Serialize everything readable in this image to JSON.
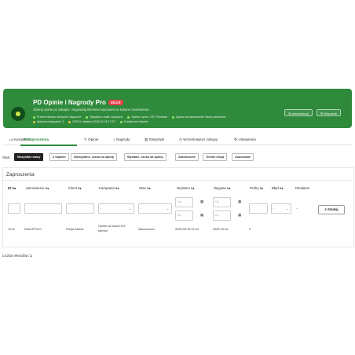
{
  "header": {
    "title": "PD Opinie i Nagrody Pro",
    "version": "v5.3.0",
    "description": "Zbieraj opinie po zakupie i nagradzaj klientów kuponami na kolejne zamówienia.",
    "statuses": [
      {
        "label": "Przeterminowe kampanii: włączone",
        "color": "#9be86a"
      },
      {
        "label": "Wysyłka e-maili: włączona",
        "color": "#9be86a"
      },
      {
        "label": "System opinii: OJIT Reviews",
        "color": "#9be86a"
      },
      {
        "label": "Zgoda na zaproszenie: ekran partnerów",
        "color": "#9be86a"
      },
      {
        "label": "Aktywne kampanie: 3",
        "color": "#f5c542"
      },
      {
        "label": "CRON: ostatnio 2026-09-26 17:07",
        "color": "#f5c542"
      },
      {
        "label": "Kolejka bez błędów",
        "color": "#9be86a"
      }
    ],
    "buttons": {
      "docs": "prestadev.pl",
      "support": "Wsparcie"
    }
  },
  "tabs": [
    {
      "label": "Kampanie",
      "icon": "thumbs-up-icon"
    },
    {
      "label": "Zaproszenia",
      "icon": "envelope-icon",
      "active": true
    },
    {
      "label": "Opinie",
      "icon": "chat-icon"
    },
    {
      "label": "Nagrody",
      "icon": "gift-icon"
    },
    {
      "label": "Statystyki",
      "icon": "bar-chart-icon"
    },
    {
      "label": "Wcześniejsze zakupy",
      "icon": "clock-icon"
    },
    {
      "label": "Ustawienia",
      "icon": "cogs-icon"
    }
  ],
  "filters": {
    "label": "Stan:",
    "options": [
      "Wszystkie stany",
      "Z błędem",
      "Niewysłane, czeka na opinię",
      "Wysłane, czeka na opinię",
      "Zakończone",
      "Termin minął",
      "Anulowane"
    ],
    "selected": "Wszystkie stany"
  },
  "panel": {
    "title": "Zaproszenia",
    "columns": {
      "id": "ID ▾▴",
      "order": "Zamówienie ▾▴",
      "client": "Klient ▾▴",
      "campaign": "Kampania ▾▴",
      "state": "Stan ▾▴",
      "sent": "Wysłano ▾▴",
      "expires": "Wygasa ▾▴",
      "attempts": "Próby ▾▴",
      "error": "Błąd ▾▴",
      "action": "Działanie"
    },
    "filter_row": {
      "select_value": "-",
      "date_from": "Od",
      "date_to": "Do",
      "search_label": "Szukaj"
    },
    "rows": [
      {
        "id": "1276",
        "order": "KNALPFICO",
        "client": "Patryk Marek",
        "campaign_line1": "Opinie za rabat 10%",
        "campaign_line2": "(demo)",
        "state": "Zakończono",
        "sent": "2026-09-18 01:22",
        "expires": "2026-10-16",
        "attempts": "0"
      }
    ]
  },
  "footer": {
    "count_label": "Liczba rekordów:",
    "count": "1"
  }
}
